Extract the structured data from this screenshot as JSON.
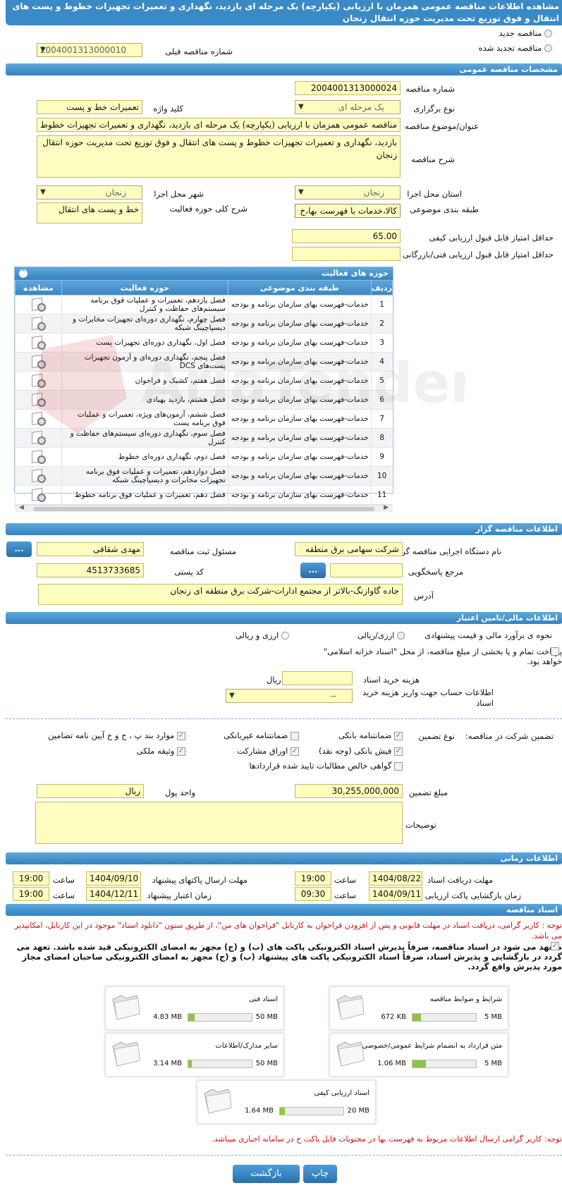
{
  "page_title": "مشاهده اطلاعات مناقصه عمومی همزمان با ارزیابی (یکپارچه) یک مرحله ای بازدید، نگهداری و تعمیرات تجهیزات خطوط و پست های انتقال و فوق توزیع تحت مدیریت حوزه انتقال زنجان",
  "top": {
    "new_tender_label": "مناقصه جدید",
    "renewed_tender_label": "مناقصه تجدید شده",
    "prev_number_label": "شماره مناقصه قبلی",
    "prev_number_value": "2004001313000010"
  },
  "general": {
    "header": "مشخصات مناقصه عمومی",
    "number_label": "شماره مناقصه",
    "number_value": "2004001313000024",
    "type_label": "نوع برگزاری",
    "type_value": "یک مرحله ای",
    "keyword_label": "کلید واژه",
    "keyword_value": "تعمیرات خط و پست",
    "subject_label": "عنوان/موضوع مناقصه",
    "subject_value": "مناقصه عمومی همزمان با ارزیابی (یکپارچه) یک مرحله ای بازدید، نگهداری و تعمیرات تجهیزات خطوط",
    "desc_label": "شرح مناقصه",
    "desc_value": "بازدید، نگهداری و تعمیرات تجهیزات خطوط و پست های انتقال و فوق توزیع تحت مدیریت حوزه انتقال زنجان",
    "province_label": "استان محل اجرا",
    "province_value": "زنجان",
    "city_label": "شهر محل اجرا",
    "city_value": "زنجان",
    "category_label": "طبقه بندی موضوعی",
    "category_value": "کالا،خدمات با فهرست بها،خ",
    "activity_desc_label": "شرح کلی حوزه فعالیت",
    "activity_desc_value": "خط و پست های انتقال",
    "min_quality_label": "حداقل امتیاز قابل قبول ارزیابی کیفی",
    "min_quality_value": "65.00",
    "min_tech_label": "حداقل امتیاز قابل قبول ارزیابی فنی/بازرگانی",
    "min_tech_value": ""
  },
  "activities": {
    "header": "حوزه های فعالیت",
    "columns": [
      "ردیف",
      "طبقه بندی موضوعی",
      "حوزه فعالیت",
      "مشاهده"
    ],
    "rows": [
      {
        "n": "1",
        "cat": "خدمات-فهرست بهای سازمان برنامه و بودجه",
        "field": "فصل یازدهم، تعمیرات و عملیات فوق برنامه سیستم‌های حفاظت و کنترل"
      },
      {
        "n": "2",
        "cat": "خدمات-فهرست بهای سازمان برنامه و بودجه",
        "field": "فصل چهارم، نگهداری دوره‌ای تجهیزات مخابرات و دیسپاچینگ شبکه"
      },
      {
        "n": "3",
        "cat": "خدمات-فهرست بهای سازمان برنامه و بودجه",
        "field": "فصل اول، نگهداری دوره‌ای تجهیزات پست"
      },
      {
        "n": "4",
        "cat": "خدمات-فهرست بهای سازمان برنامه و بودجه",
        "field": "فصل پنجم، نگهداری دوره‌ای و آزمون تجهیزات پست‌های DCS"
      },
      {
        "n": "5",
        "cat": "خدمات-فهرست بهای سازمان برنامه و بودجه",
        "field": "فصل هفتم، کشیک و فراخوان"
      },
      {
        "n": "6",
        "cat": "خدمات-فهرست بهای سازمان برنامه و بودجه",
        "field": "فصل هشتم، بازدید بهبادی"
      },
      {
        "n": "7",
        "cat": "خدمات-فهرست بهای سازمان برنامه و بودجه",
        "field": "فصل ششم، آزمون‌های ویژه، تعمیرات و عملیات فوق برنامه پست"
      },
      {
        "n": "8",
        "cat": "خدمات-فهرست بهای سازمان برنامه و بودجه",
        "field": "فصل سوم، نگهداری دوره‌ای سیستم‌های حفاظت و کنترل"
      },
      {
        "n": "9",
        "cat": "خدمات-فهرست بهای سازمان برنامه و بودجه",
        "field": "فصل دوم، نگهداری دوره‌ای خطوط"
      },
      {
        "n": "10",
        "cat": "خدمات-فهرست بهای سازمان برنامه و بودجه",
        "field": "فصل دوازدهم، تعمیرات و عملیات فوق برنامه تجهیزات مخابرات و دیسپاچینگ شبکه"
      },
      {
        "n": "11",
        "cat": "خدمات-فهرست بهای سازمان برنامه و بودجه",
        "field": "فصل دهم، تعمیرات و عملیات فوق برنامه خطوط"
      }
    ]
  },
  "organizer": {
    "header": "اطلاعات مناقصه گزار",
    "org_label": "نام دستگاه اجرایی مناقصه گزار",
    "org_value": "شرکت سهامی برق منطقه",
    "responsible_label": "مسئول ثبت مناقصه",
    "responsible_value": "مهدی شقاقی",
    "dots_label": "...",
    "reference_label": "مرجع پاسخگویی",
    "reference_value": "",
    "postal_label": "کد پستی",
    "postal_value": "4513733685",
    "address_label": "آدرس",
    "address_value": "جاده گاوازنگ-بالاتر از مجتمع ادارات-شرکت برق منطقه ای زنجان"
  },
  "finance": {
    "header": "اطلاعات مالی/تامین اعتبار",
    "estimate_label": "نحوه ی برآورد مالی و قیمت پیشنهادی",
    "opt_rial": "ارزی/ریالی",
    "opt_fx": "ارزی و ریالی",
    "treasury_text": "پرداخت تمام و یا بخشی از مبلغ مناقصه، از محل \"اسناد خزانه اسلامی\" خواهد بود.",
    "doc_cost_label": "هزینه خرید اسناد",
    "doc_cost_unit": "ریال",
    "account_label": "اطلاعات حساب جهت واریز هزینه خرید اسناد",
    "account_value": "--"
  },
  "guarantee": {
    "label": "تضمین شرکت در مناقصه:",
    "type_label": "نوع تضمین",
    "items": {
      "bank": "ضمانتنامه بانکی",
      "nonbank": "ضمانتنامه غیربانکی",
      "article": "موارد بند پ ، ج و خ آیین نامه تضامین",
      "cash": "فیش بانکی (وجه نقد)",
      "bonds": "اوراق مشارکت",
      "property": "وثیقه ملکی",
      "claims": "گواهی خالص مطالبات تایید شده قراردادها"
    },
    "amount_label": "مبلغ تضمین",
    "amount_value": "30,255,000,000",
    "currency_label": "واحد پول",
    "currency_value": "ریال",
    "notes_label": "توضیحات",
    "notes_value": ""
  },
  "timing": {
    "header": "اطلاعات زمانی",
    "receive_label": "مهلت دریافت اسناد",
    "receive_date": "1404/08/22",
    "receive_time": "19:00",
    "submit_label": "مهلت ارسال پاکتهای پیشنهاد",
    "submit_date": "1404/09/10",
    "submit_time": "19:00",
    "open_label": "زمان بازگشایی پاکت ارزیابی کیفی",
    "open_date": "1404/09/11",
    "open_time": "09:30",
    "valid_label": "زمان اعتبار پیشنهاد",
    "valid_date": "1404/12/11",
    "valid_time": "19:00",
    "time_label": "ساعت"
  },
  "documents": {
    "header": "اسناد مناقصه",
    "note1": "توجه : کاربر گرامی، دریافت اسناد در مهلت قانونی و پس از افزودن فراخوان به کارتابل \"فراخوان های من\"، از طریق ستون \"دانلود اسناد\" موجود در این کارتابل، امکانپذیر می باشد.",
    "commit_text": "متعهد می شود در اسناد مناقصه، صرفاً پذیرش اسناد الکترونیکی پاکت های (ب) و (ج) مجهز به امضای الکترونیکی قید شده باشد. تعهد می گردد در بازگشایی و پذیرش اسناد، صرفاً اسناد الکترونیکی پاکت های پیشنهاد (ب) و (ج) مجهز به امضای الکترونیکی صاحبان امضای مجاز مورد پذیرش واقع گردد.",
    "files": [
      {
        "name": "شرایط و ضوابط مناقصه",
        "size": "672 KB",
        "max": "5 MB",
        "fill": 0.13
      },
      {
        "name": "اسناد فنی",
        "size": "4.83 MB",
        "max": "50 MB",
        "fill": 0.1
      },
      {
        "name": "متن قرارداد به انضمام شرایط عمومی/خصوصی",
        "size": "1.06 MB",
        "max": "5 MB",
        "fill": 0.21
      },
      {
        "name": "سایر مدارک/اطلاعات",
        "size": "3.14 MB",
        "max": "50 MB",
        "fill": 0.06
      },
      {
        "name": "اسناد ارزیابی کیفی",
        "size": "1.64 MB",
        "max": "20 MB",
        "fill": 0.08
      }
    ],
    "note2": "توجه: کاربر گرامی ارسال اطلاعات مربوط به فهرست بها در محتویات فایل پاکت ج در سامانه اجباری میباشد."
  },
  "footer": {
    "print_label": "چاپ",
    "back_label": "بازگشت"
  },
  "colors": {
    "header": "#3a8ac6",
    "input_bg": "#fefdc0",
    "note": "#d01010"
  }
}
